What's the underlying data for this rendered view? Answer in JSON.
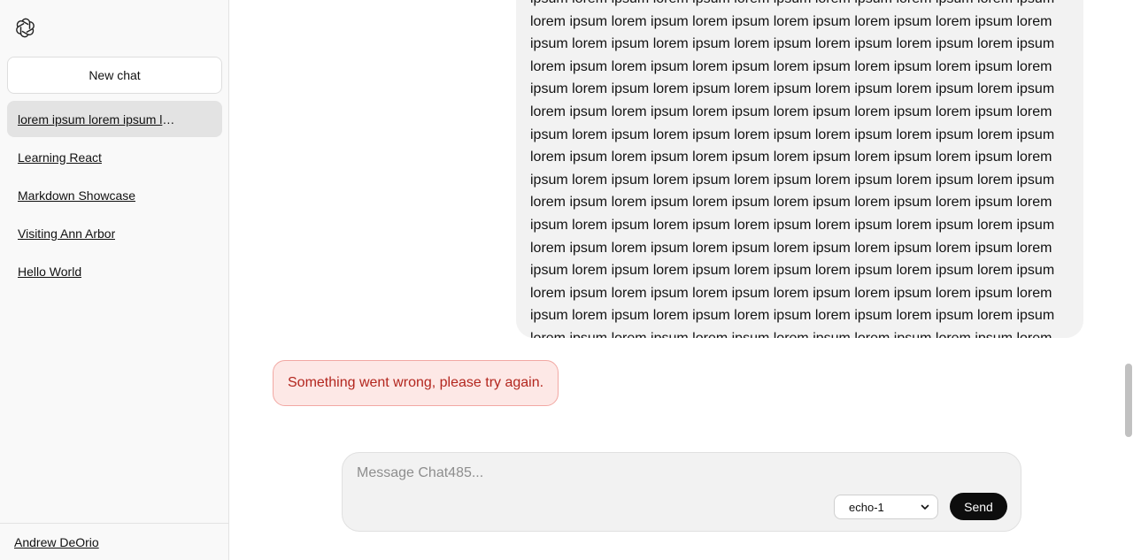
{
  "sidebar": {
    "new_chat_label": "New chat",
    "conversations": [
      {
        "title": "lorem ipsum lorem ipsum lorem ipsum",
        "active": true
      },
      {
        "title": "Learning React",
        "active": false
      },
      {
        "title": "Markdown Showcase",
        "active": false
      },
      {
        "title": "Visiting Ann Arbor",
        "active": false
      },
      {
        "title": "Hello World",
        "active": false
      }
    ],
    "user_name": "Andrew DeOrio"
  },
  "messages": {
    "user_message": "ipsum lorem ipsum lorem ipsum lorem ipsum lorem ipsum lorem ipsum lorem ipsum lorem ipsum lorem ipsum lorem ipsum lorem ipsum lorem ipsum lorem ipsum lorem ipsum lorem ipsum lorem ipsum lorem ipsum lorem ipsum lorem ipsum lorem ipsum lorem ipsum lorem ipsum lorem ipsum lorem ipsum lorem ipsum lorem ipsum lorem ipsum lorem ipsum lorem ipsum lorem ipsum lorem ipsum lorem ipsum lorem ipsum lorem ipsum lorem ipsum lorem ipsum lorem ipsum lorem ipsum lorem ipsum lorem ipsum lorem ipsum lorem ipsum lorem ipsum lorem ipsum lorem ipsum lorem ipsum lorem ipsum lorem ipsum lorem ipsum lorem ipsum lorem ipsum lorem ipsum lorem ipsum lorem ipsum lorem ipsum lorem ipsum lorem ipsum lorem ipsum lorem ipsum lorem ipsum lorem ipsum lorem ipsum lorem ipsum lorem ipsum lorem ipsum lorem ipsum lorem ipsum lorem ipsum lorem ipsum lorem ipsum lorem ipsum lorem ipsum lorem ipsum lorem ipsum lorem ipsum lorem ipsum lorem ipsum lorem ipsum lorem ipsum lorem ipsum lorem ipsum lorem ipsum lorem ipsum lorem ipsum lorem ipsum lorem ipsum lorem ipsum lorem ipsum lorem ipsum lorem ipsum lorem ipsum lorem ipsum lorem ipsum lorem ipsum lorem ipsum lorem ipsum lorem ipsum lorem ipsum lorem ipsum lorem ipsum lorem ipsum lorem ipsum lorem ipsum lorem ipsum lorem ipsum lorem ipsum lorem ipsum lorem ipsum lorem ipsum lorem ipsum lorem ipsum lorem ipsum lorem ipsum lorem ipsum lorem ipsum lorem ipsum lorem ipsum lorem ipsum lorem ipsum lorem ipsum lorem ipsum lorem ipsum lorem ipsum lorem ipsum lorem ipsum lorem ipsum lorem ipsum lorem ipsum lorem ipsum lorem ipsum",
    "error_text": "Something went wrong, please try again."
  },
  "composer": {
    "placeholder": "Message Chat485...",
    "value": "",
    "model_selected": "echo-1",
    "send_label": "Send"
  },
  "icons": {
    "logo": "openai-logo-icon",
    "select_chevron": "chevron-down-icon"
  },
  "colors": {
    "sidebar_bg": "#f9f9f9",
    "active_item_bg": "#e3e3e3",
    "user_bubble_bg": "#f2f2f2",
    "error_bg": "#fde8e6",
    "error_text": "#b3261e",
    "send_button_bg": "#0d0d0d"
  }
}
